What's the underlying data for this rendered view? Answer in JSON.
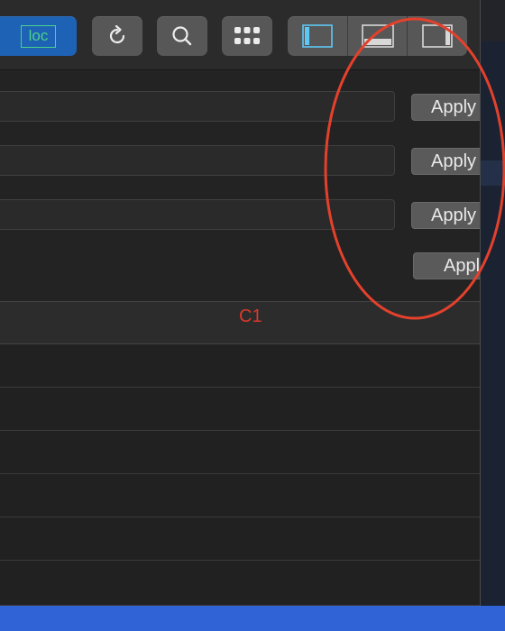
{
  "toolbar": {
    "location_label": "loc",
    "icons": {
      "reload": "reload-icon",
      "search": "search-icon",
      "grid": "grid-icon",
      "left_panel": "sidebar-left-icon",
      "bottom_panel": "panel-bottom-icon",
      "right_panel": "sidebar-right-icon"
    }
  },
  "form": {
    "fields": [
      {
        "value": ""
      },
      {
        "value": ""
      },
      {
        "value": ""
      }
    ],
    "apply_labels": [
      "Apply",
      "Apply",
      "Apply",
      "Apply"
    ]
  },
  "table": {
    "columns": [
      "C1"
    ],
    "rows": [
      [
        ""
      ],
      [
        ""
      ],
      [
        ""
      ],
      [
        ""
      ],
      [
        ""
      ],
      [
        ""
      ]
    ]
  },
  "colors": {
    "accent_blue": "#1d62b4",
    "location_green": "#4bd38a",
    "column_header_red": "#d8392b",
    "annotation_red": "#e4412c",
    "selection_bar": "#2f63d6"
  }
}
